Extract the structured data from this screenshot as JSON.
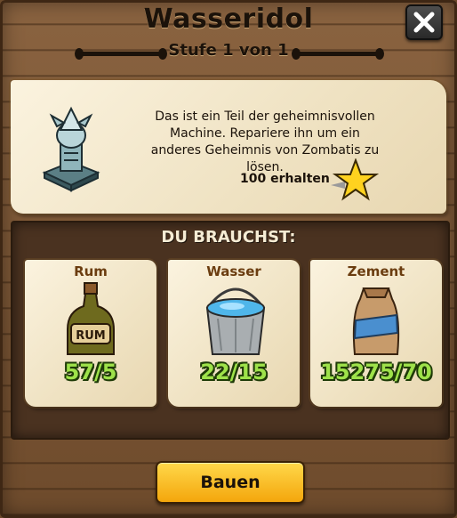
{
  "dialog": {
    "title": "Wasseridol",
    "subtitle": "Stufe 1 von 1",
    "close_icon": "close-icon"
  },
  "info": {
    "description": "Das ist ein Teil der geheimnisvollen Machine. Repariere ihn um ein anderes Geheimnis von Zombatis zu lösen.",
    "reward_label": "100 erhalten",
    "reward_icon": "star-icon"
  },
  "requirements": {
    "heading": "DU BRAUCHST:",
    "items": [
      {
        "label": "Rum",
        "count": "57/5",
        "icon": "rum-bottle-icon"
      },
      {
        "label": "Wasser",
        "count": "22/15",
        "icon": "water-bucket-icon"
      },
      {
        "label": "Zement",
        "count": "15275/70",
        "icon": "cement-bag-icon"
      }
    ]
  },
  "actions": {
    "build_label": "Bauen"
  },
  "colors": {
    "accent_button": "#f4a60c",
    "count_text": "#9ee24a",
    "item_label": "#6b3d10"
  }
}
